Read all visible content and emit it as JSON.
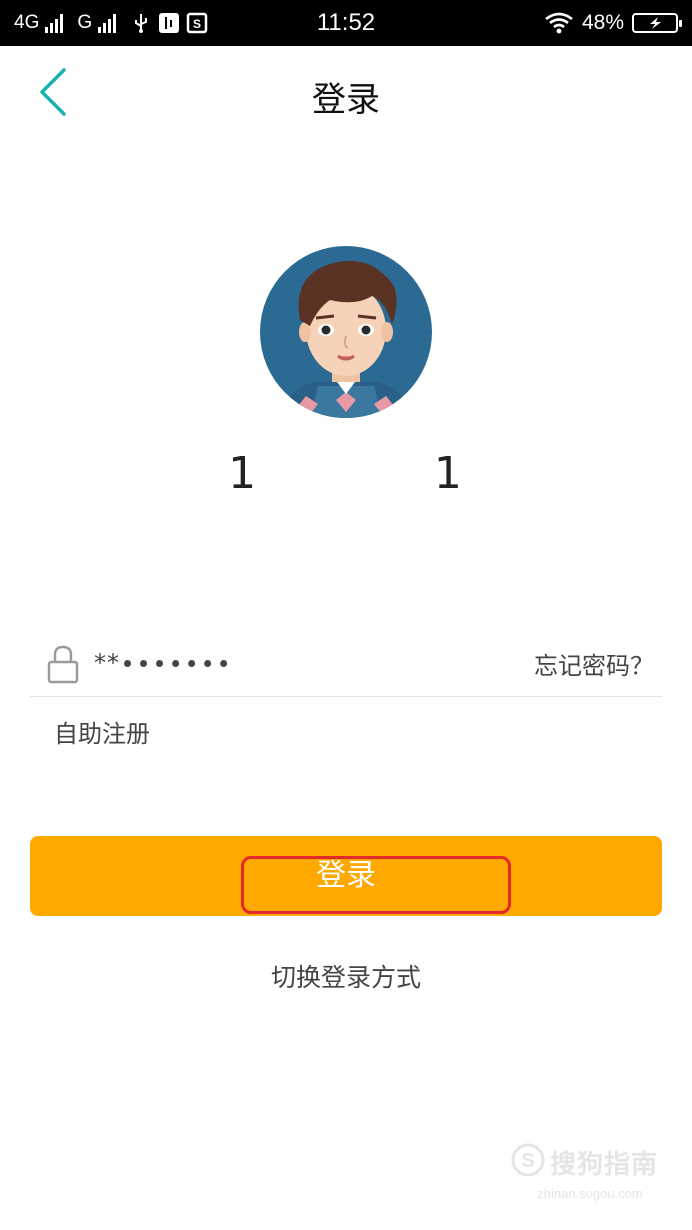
{
  "status_bar": {
    "network_1": "4G",
    "network_2": "G",
    "time": "11:52",
    "battery_percent": "48%",
    "battery_level": 0.48,
    "icons": [
      "signal-icon",
      "usb-icon",
      "usb-debug-icon",
      "sim-icon",
      "wifi-icon",
      "battery-icon"
    ]
  },
  "nav": {
    "back_icon": "chevron-left-icon",
    "title": "登录",
    "accent_color": "#1ab3b0"
  },
  "account": {
    "avatar_icon": "avatar-icon",
    "phone_masked": "1           1"
  },
  "password": {
    "lock_icon": "lock-icon",
    "value": "**∙∙∙∙∙∙∙",
    "forgot_label": "忘记密码？"
  },
  "register_label": "自助注册",
  "login": {
    "label": "登录",
    "color": "#fea800",
    "highlight_color": "#e32a2a"
  },
  "switch_label": "切换登录方式",
  "watermark": {
    "logo_icon": "sogou-logo-icon",
    "text": "搜狗指南",
    "url": "zhinan.sogou.com"
  }
}
